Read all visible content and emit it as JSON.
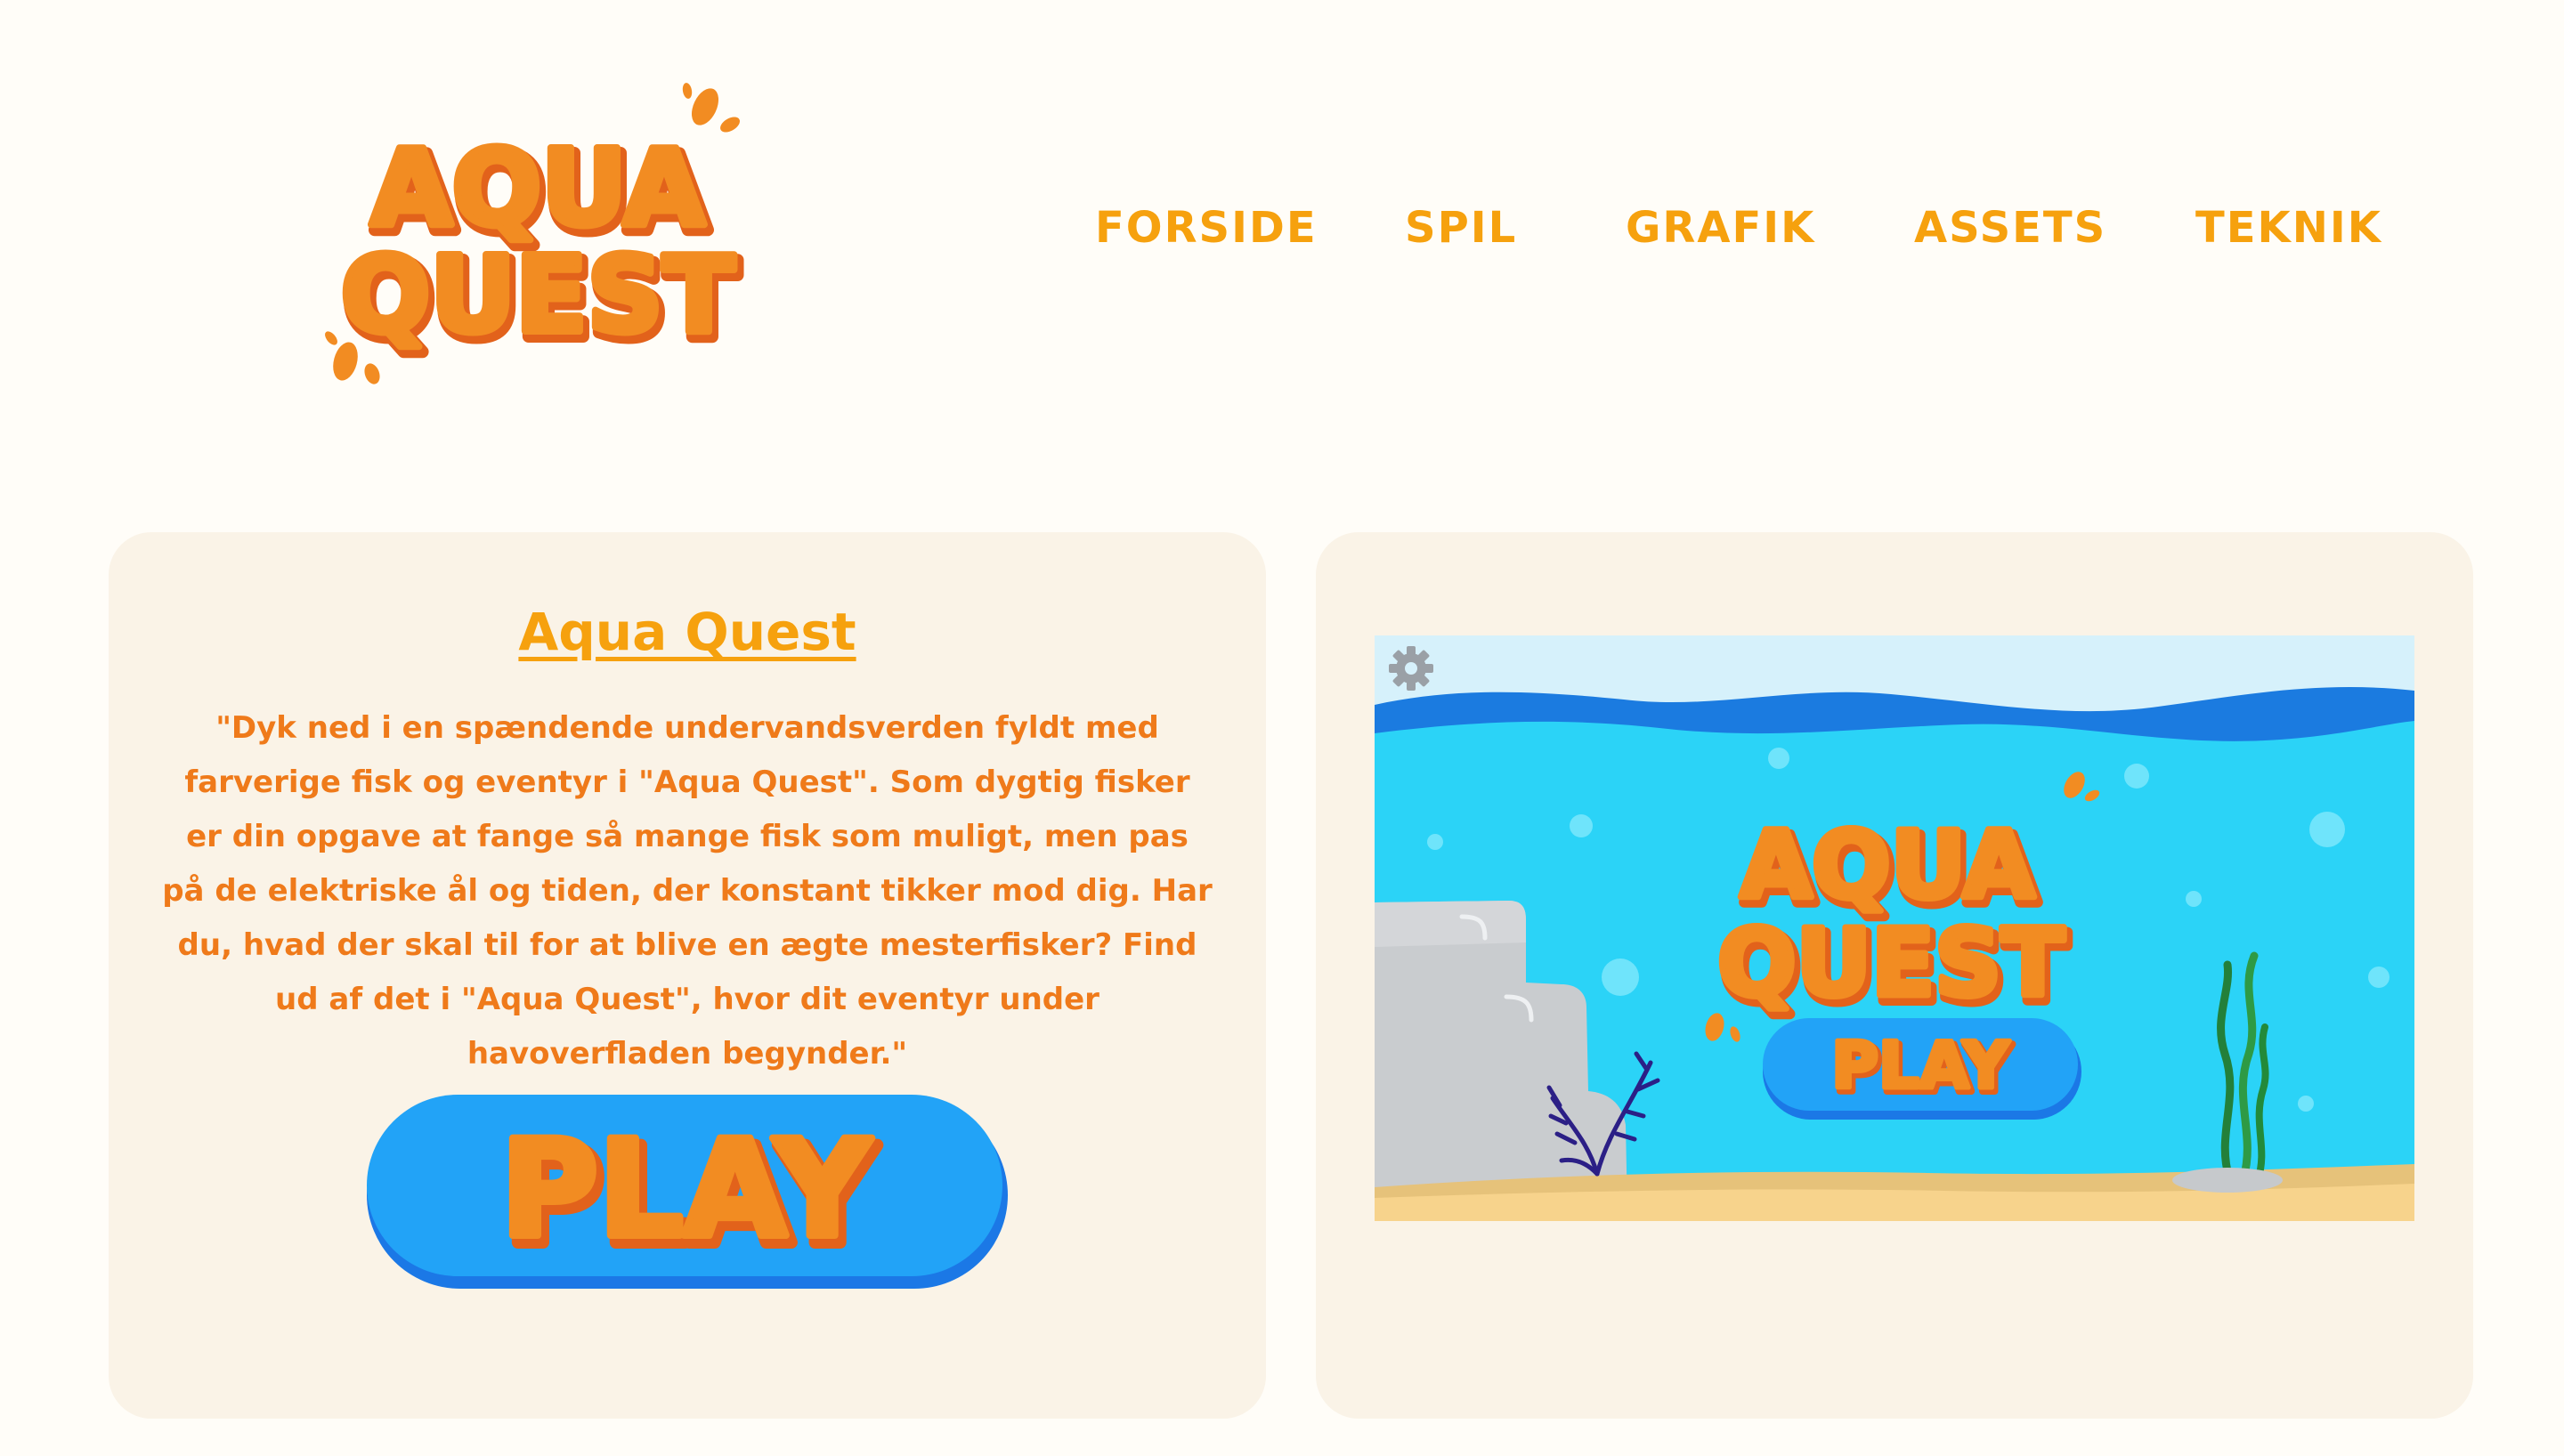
{
  "logo": {
    "line1": "AQUA",
    "line2": "QUEST"
  },
  "nav": [
    {
      "label": "FORSIDE"
    },
    {
      "label": "SPIL"
    },
    {
      "label": "GRAFIK"
    },
    {
      "label": "ASSETS"
    },
    {
      "label": "TEKNIK"
    }
  ],
  "intro": {
    "title": "Aqua Quest",
    "description": "\"Dyk ned i en spændende undervandsverden fyldt med farverige fisk og eventyr i \"Aqua Quest\". Som dygtig fisker er din opgave at fange så mange fisk som muligt, men pas på de elektriske ål og tiden, der konstant tikker mod dig. Har du, hvad der skal til for at blive en ægte mesterfisker? Find ud af det i \"Aqua Quest\", hvor dit eventyr under havoverfladen begynder.\"",
    "play_label": "PLAY"
  },
  "game_preview": {
    "logo_line1": "AQUA",
    "logo_line2": "QUEST",
    "play_label": "PLAY",
    "settings_icon": "gear-icon"
  },
  "colors": {
    "orange": "#f28c22",
    "orange_dark": "#e2621b",
    "nav": "#f6a10e",
    "text": "#ef7a1a",
    "card_bg": "#faf3e7",
    "button_blue": "#22a3f7",
    "button_blue_dark": "#1b78e6",
    "water": "#2bd3f7",
    "sand": "#f7d38c"
  }
}
